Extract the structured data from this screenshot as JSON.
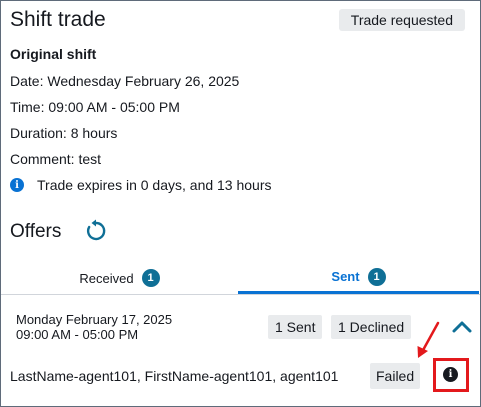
{
  "header": {
    "title": "Shift trade",
    "status_badge": "Trade requested"
  },
  "original_shift": {
    "heading": "Original shift",
    "date_label": "Date:",
    "date_value": "Wednesday February 26, 2025",
    "time_label": "Time:",
    "time_value": "09:00 AM - 05:00 PM",
    "duration_label": "Duration:",
    "duration_value": "8 hours",
    "comment_label": "Comment:",
    "comment_value": "test",
    "info_icon": "info-icon",
    "expiry_text": "Trade expires in 0 days, and 13 hours"
  },
  "offers": {
    "title": "Offers",
    "refresh_icon": "refresh-icon",
    "tabs": [
      {
        "label": "Received",
        "count": "1"
      },
      {
        "label": "Sent",
        "count": "1"
      }
    ],
    "item": {
      "date": "Monday February 17, 2025",
      "time": "09:00 AM - 05:00 PM",
      "sent_chip": "1 Sent",
      "declined_chip": "1 Declined",
      "agent": "LastName-agent101, FirstName-agent101, agent101",
      "status": "Failed"
    }
  },
  "colors": {
    "accent": "#0972d3",
    "tab_badge": "#0f6f96",
    "highlight": "#e3191c"
  }
}
